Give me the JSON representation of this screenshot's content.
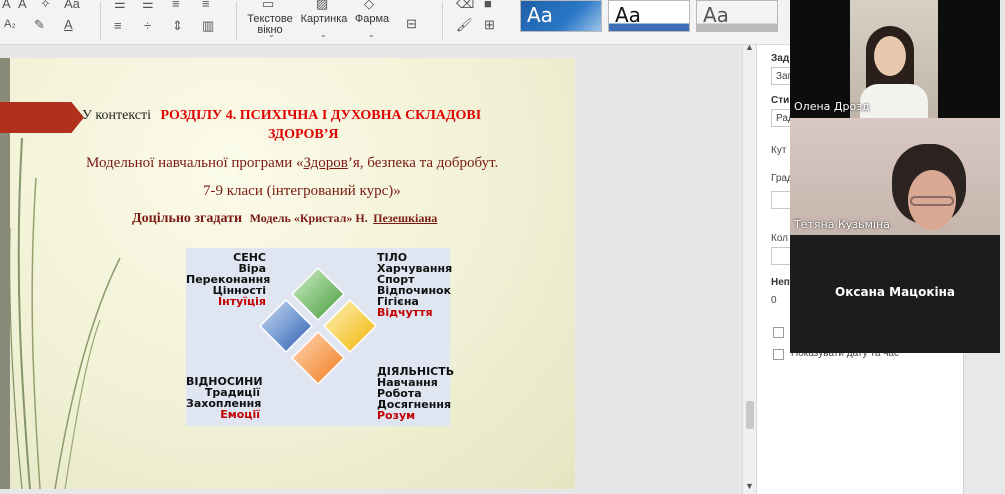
{
  "ribbon": {
    "text_box_label": "Текстове вікно",
    "picture_label": "Картинка",
    "shape_label": "Фарма",
    "style_sample": "Aa"
  },
  "slide": {
    "intro": "У контексті",
    "heading_line1": "РОЗДІЛУ 4. ПСИХІЧНА І ДУХОВНА СКЛАДОВІ",
    "heading_line2": "ЗДОРОВ’Я",
    "program_prefix": "Модельної навчальної програми «",
    "program_link": "Здоров",
    "program_suffix": "’я, безпека та добробут.",
    "grades": "7-9 класи  (інтегрований курс)»",
    "recall_bold": "Доцільно згадати",
    "recall_model": "Модель «Кристал» Н.",
    "recall_name": "Пезешкіана",
    "model": {
      "sense": [
        "СЕНС",
        "Віра",
        "Переконання",
        "Цінності"
      ],
      "sense_red": "Інтуїція",
      "body": [
        "ТІЛО",
        "Харчування",
        "Спорт",
        "Відпочинок",
        "Гігієна"
      ],
      "body_red": "Відчуття",
      "relations": [
        "ВІДНОСИНИ",
        "Традиції",
        "Захоплення"
      ],
      "relations_red": "Емоції",
      "activity": [
        "ДІЯЛЬНІСТЬ",
        "Навчання",
        "Робота",
        "Досягнення"
      ],
      "activity_red": "Розум"
    }
  },
  "panel": {
    "l1": "Зад",
    "v1": "Зап",
    "l2": "Сти",
    "v2": "Рад",
    "l3": "Кут",
    "l4": "Град",
    "l5": "Кол",
    "l6": "Неп",
    "v6": "0",
    "show_date": "Показувати дату та час"
  },
  "video": {
    "p1": "Олена Дрозд",
    "p2": "Тетяна Кузьміна",
    "p3": "Оксана Мацокіна"
  },
  "colors": {
    "accent": "#b0301c",
    "heading_red": "#e00000"
  }
}
